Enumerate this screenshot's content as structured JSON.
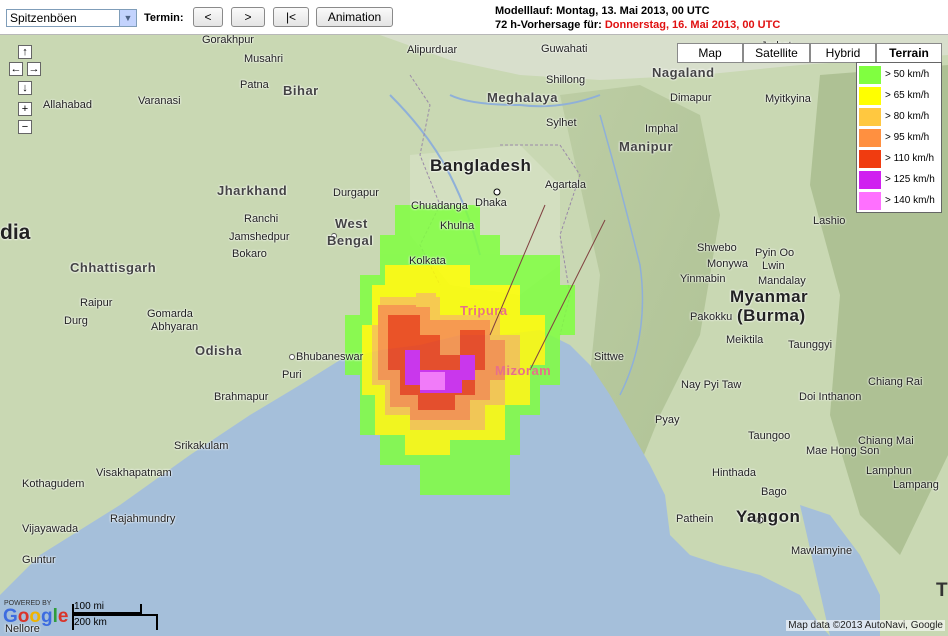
{
  "toolbar": {
    "parameter_select": "Spitzenböen",
    "termin_label": "Termin:",
    "prev_label": "<",
    "next_label": ">",
    "first_label": "|<",
    "animation_label": "Animation",
    "model_run": "Modelllauf: Montag, 13. Mai 2013, 00 UTC",
    "forecast_prefix": "72 h-Vorhersage für: ",
    "forecast_date": "Donnerstag, 16. Mai 2013, 00 UTC"
  },
  "map_types": [
    "Map",
    "Satellite",
    "Hybrid",
    "Terrain"
  ],
  "active_map_type": "Terrain",
  "legend": [
    {
      "label": "> 50 km/h",
      "color": "#80ff40"
    },
    {
      "label": "> 65 km/h",
      "color": "#ffff00"
    },
    {
      "label": "> 80 km/h",
      "color": "#ffc840"
    },
    {
      "label": "> 95 km/h",
      "color": "#ff9040"
    },
    {
      "label": "> 110 km/h",
      "color": "#f03c10"
    },
    {
      "label": "> 125 km/h",
      "color": "#d020f0"
    },
    {
      "label": "> 140 km/h",
      "color": "#ff70ff"
    }
  ],
  "map_labels": {
    "india": "dia",
    "bihar": "Bihar",
    "jharkhand": "Jharkhand",
    "west_bengal_1": "West",
    "west_bengal_2": "Bengal",
    "chhattisgarh": "Chhattisgarh",
    "odisha": "Odisha",
    "bangladesh": "Bangladesh",
    "meghalaya": "Meghalaya",
    "nagaland": "Nagaland",
    "manipur": "Manipur",
    "tripura": "Tripura",
    "mizoram": "Mizoram",
    "myanmar_1": "Myanmar",
    "myanmar_2": "(Burma)",
    "gorakhpur": "Gorakhpur",
    "musahri": "Musahri",
    "allahabad": "Allahabad",
    "varanasi": "Varanasi",
    "patna": "Patna",
    "alipurduar": "Alipurduar",
    "guwahati": "Guwahati",
    "dimapur": "Dimapur",
    "jorhat": "Jorhat",
    "myitkyina": "Myitkyina",
    "shillong": "Shillong",
    "sylhet": "Sylhet",
    "imphal": "Imphal",
    "agartala": "Agartala",
    "dhaka": "Dhaka",
    "khulna": "Khulna",
    "kolkata": "Kolkata",
    "chuadanga": "Chuadanga",
    "durgapur": "Durgapur",
    "bokaro": "Bokaro",
    "ranchi": "Ranchi",
    "jamshedpur": "Jamshedpur",
    "raipur": "Raipur",
    "durg": "Durg",
    "gomarda": "Gomarda",
    "abhyaran": "Abhyaran",
    "bhubaneswar": "Bhubaneswar",
    "puri": "Puri",
    "brahmapur": "Brahmapur",
    "srikakulam": "Srikakulam",
    "visakhapatnam": "Visakhapatnam",
    "kothagudem": "Kothagudem",
    "vijayawada": "Vijayawada",
    "rajahmundry": "Rajahmundry",
    "guntur": "Guntur",
    "nellore": "Nellore",
    "sittwe": "Sittwe",
    "monywa": "Monywa",
    "shwebo": "Shwebo",
    "yinmabin": "Yinmabin",
    "pyin_oo": "Pyin Oo",
    "lwin": "Lwin",
    "lashio": "Lashio",
    "mandalay": "Mandalay",
    "pakokku": "Pakokku",
    "meiktila": "Meiktila",
    "taunggyi": "Taunggyi",
    "nay_pyi_taw": "Nay Pyi Taw",
    "pyay": "Pyay",
    "taungoo": "Taungoo",
    "hinthada": "Hinthada",
    "bago": "Bago",
    "yangon": "Yangon",
    "pathein": "Pathein",
    "mawlamyine": "Mawlamyine",
    "chiang_rai": "Chiang Rai",
    "chiang_mai": "Chiang Mai",
    "lampang": "Lampang",
    "mae_hong_son": "Mae Hong Son",
    "lamphun": "Lamphun",
    "doi_inthanon": "Doi Inthanon",
    "ye": "Ye",
    "thailand_T": "T"
  },
  "scale": {
    "mi": "100 mi",
    "km": "200 km"
  },
  "logo": {
    "powered": "POWERED BY",
    "g": "G",
    "o1": "o",
    "o2": "o",
    "g2": "g",
    "l": "l",
    "e": "e"
  },
  "copyright": "Map data ©2013 AutoNavi, Google"
}
